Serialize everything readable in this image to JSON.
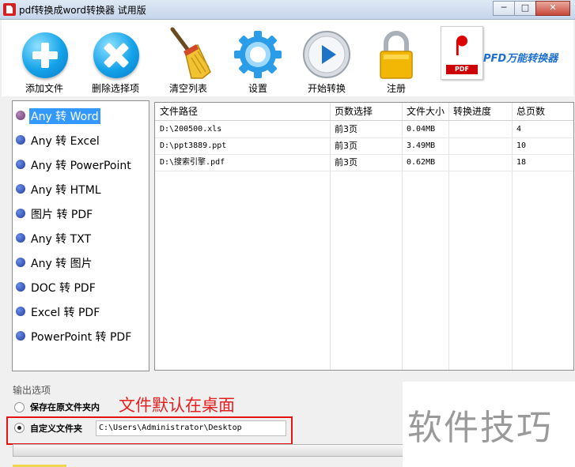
{
  "window": {
    "title": "pdf转换成word转换器 试用版"
  },
  "toolbar": {
    "add_file": "添加文件",
    "delete_selected": "删除选择项",
    "clear_list": "清空列表",
    "settings": "设置",
    "start_convert": "开始转换",
    "register": "注册",
    "logo_text": "PFD万能转换器",
    "logo_pdf": "PDF"
  },
  "conversions": {
    "selected_index": 0,
    "items": [
      "Any 转 Word",
      "Any 转 Excel",
      "Any 转 PowerPoint",
      "Any 转 HTML",
      "图片 转 PDF",
      "Any 转 TXT",
      "Any 转 图片",
      "DOC 转 PDF",
      "Excel 转 PDF",
      "PowerPoint 转 PDF"
    ]
  },
  "file_table": {
    "columns": [
      "文件路径",
      "页数选择",
      "文件大小",
      "转换进度",
      "总页数"
    ],
    "rows": [
      {
        "path": "D:\\200500.xls",
        "pages": "前3页",
        "size": "0.04MB",
        "progress": "",
        "total": "4"
      },
      {
        "path": "D:\\ppt3889.ppt",
        "pages": "前3页",
        "size": "3.49MB",
        "progress": "",
        "total": "10"
      },
      {
        "path": "D:\\搜索引擎.pdf",
        "pages": "前3页",
        "size": "0.62MB",
        "progress": "",
        "total": "18"
      }
    ]
  },
  "output": {
    "title": "输出选项",
    "keep_original": "保存在原文件夹内",
    "custom_folder": "自定义文件夹",
    "custom_path": "C:\\Users\\Administrator\\Desktop",
    "selected": "custom_folder"
  },
  "annotation": "文件默认在桌面",
  "watermark": "软件技巧",
  "colors": {
    "accent": "#3399ff",
    "annotation": "#e52020",
    "logo_text": "#1d6fd0"
  }
}
